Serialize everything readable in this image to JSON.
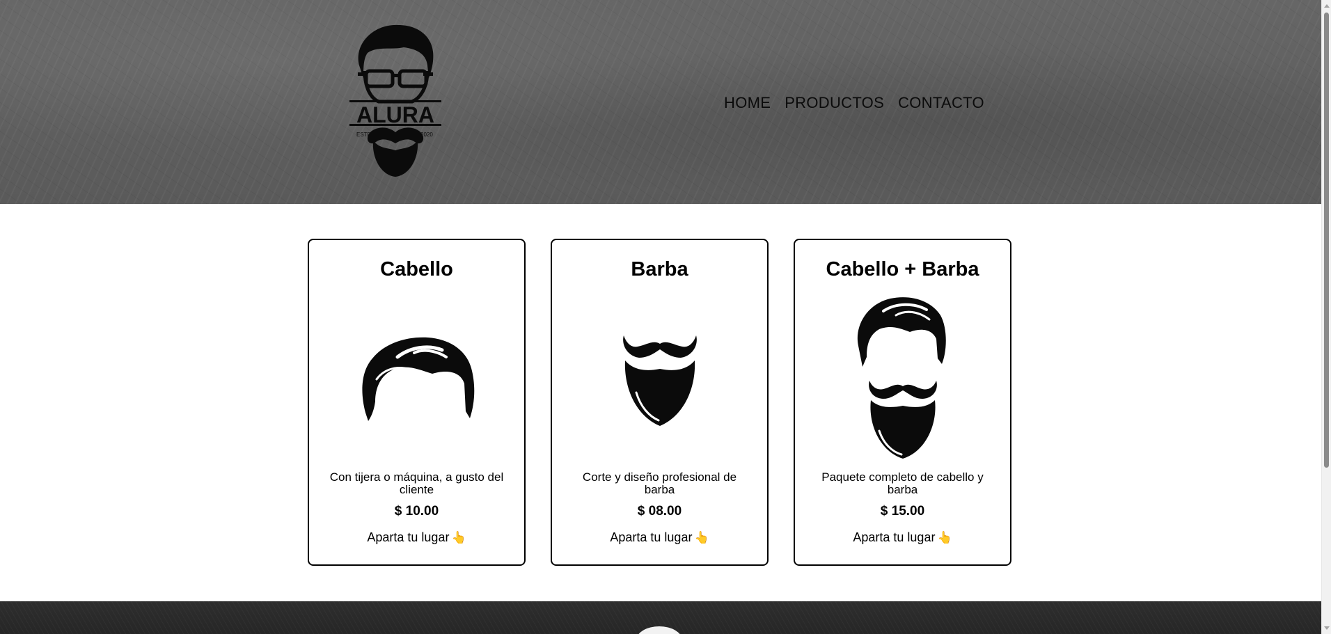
{
  "header": {
    "logo": {
      "brand": "ALURA",
      "left_text": "ESTD",
      "right_text": "2020"
    },
    "nav": [
      {
        "label": "HOME"
      },
      {
        "label": "PRODUCTOS"
      },
      {
        "label": "CONTACTO"
      }
    ]
  },
  "products": [
    {
      "title": "Cabello",
      "icon": "hair-icon",
      "description": "Con tijera o máquina, a gusto del cliente",
      "price": "$ 10.00",
      "cta": "Aparta tu lugar"
    },
    {
      "title": "Barba",
      "icon": "beard-icon",
      "description": "Corte y diseño profesional de barba",
      "price": "$ 08.00",
      "cta": "Aparta tu lugar"
    },
    {
      "title": "Cabello + Barba",
      "icon": "hair-and-beard-icon",
      "description": "Paquete completo de cabello y barba",
      "price": "$ 15.00",
      "cta": "Aparta tu lugar"
    }
  ],
  "cta_icon": "pointing-hand-icon",
  "colors": {
    "header_bg": "#5e5e5e",
    "footer_bg": "#2a2a2a",
    "card_border": "#000000",
    "hand_emoji": "#f0b429"
  }
}
